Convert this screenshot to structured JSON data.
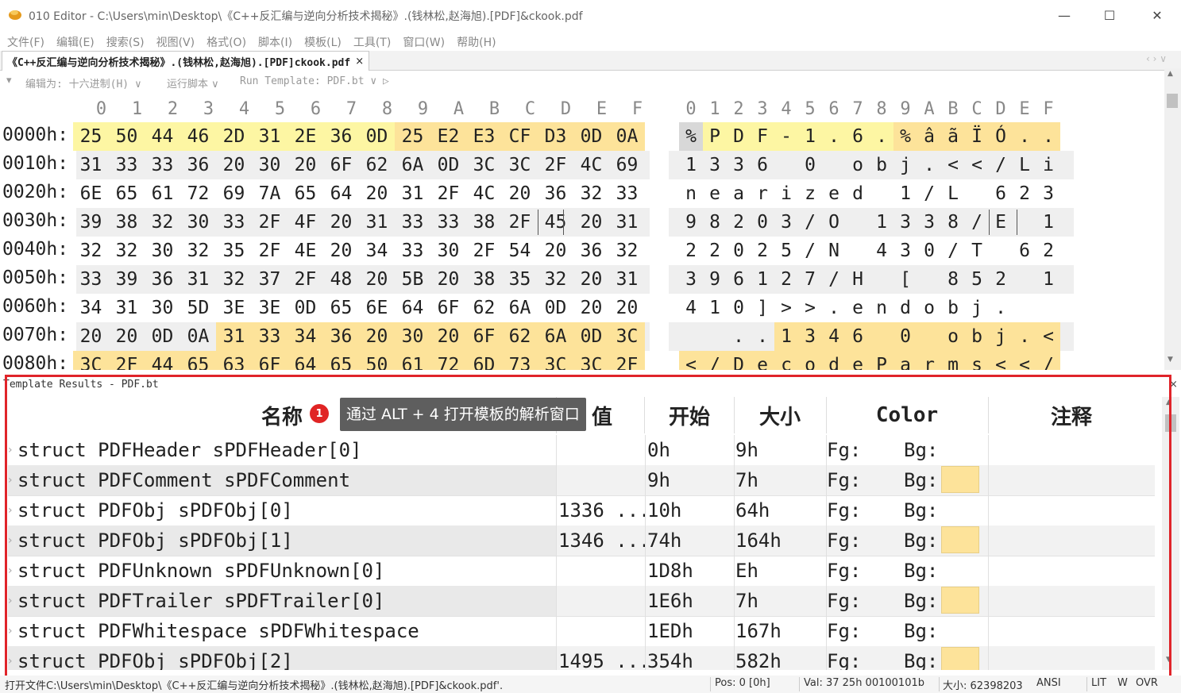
{
  "window": {
    "title": "010 Editor - C:\\Users\\min\\Desktop\\《C++反汇编与逆向分析技术揭秘》.(钱林松,赵海旭).[PDF]&ckook.pdf",
    "min": "—",
    "max": "☐",
    "close": "✕"
  },
  "menu": [
    "文件(F)",
    "编辑(E)",
    "搜索(S)",
    "视图(V)",
    "格式(O)",
    "脚本(I)",
    "模板(L)",
    "工具(T)",
    "窗口(W)",
    "帮助(H)"
  ],
  "tab": {
    "label": "《C++反汇编与逆向分析技术揭秘》.(钱林松,赵海旭).[PDF]ckook.pdf",
    "close": "×",
    "nav": "‹ › ∨"
  },
  "toolbar": {
    "edit_as_label": "编辑为: 十六进制(H) ∨",
    "run_script_label": "运行脚本 ∨",
    "run_template_label": "Run Template: PDF.bt ∨ ▷"
  },
  "hex": {
    "columns": [
      "0",
      "1",
      "2",
      "3",
      "4",
      "5",
      "6",
      "7",
      "8",
      "9",
      "A",
      "B",
      "C",
      "D",
      "E",
      "F"
    ],
    "text_columns": [
      "0",
      "1",
      "2",
      "3",
      "4",
      "5",
      "6",
      "7",
      "8",
      "9",
      "A",
      "B",
      "C",
      "D",
      "E",
      "F"
    ],
    "highlight_color": "#fdf6a3",
    "struct_color": "#fde39a",
    "rows": [
      {
        "addr": "0000h:",
        "bytes": [
          "25",
          "50",
          "44",
          "46",
          "2D",
          "31",
          "2E",
          "36",
          "0D",
          "25",
          "E2",
          "E3",
          "CF",
          "D3",
          "0D",
          "0A"
        ],
        "text": [
          "%",
          "P",
          "D",
          "F",
          "-",
          "1",
          ".",
          "6",
          ".",
          "%",
          "â",
          "ã",
          "Ï",
          "Ó",
          ".",
          "."
        ]
      },
      {
        "addr": "0010h:",
        "bytes": [
          "31",
          "33",
          "33",
          "36",
          "20",
          "30",
          "20",
          "6F",
          "62",
          "6A",
          "0D",
          "3C",
          "3C",
          "2F",
          "4C",
          "69"
        ],
        "text": [
          "1",
          "3",
          "3",
          "6",
          " ",
          "0",
          " ",
          "o",
          "b",
          "j",
          ".",
          "<",
          "<",
          "/",
          "L",
          "i"
        ]
      },
      {
        "addr": "0020h:",
        "bytes": [
          "6E",
          "65",
          "61",
          "72",
          "69",
          "7A",
          "65",
          "64",
          "20",
          "31",
          "2F",
          "4C",
          "20",
          "36",
          "32",
          "33"
        ],
        "text": [
          "n",
          "e",
          "a",
          "r",
          "i",
          "z",
          "e",
          "d",
          " ",
          "1",
          "/",
          "L",
          " ",
          "6",
          "2",
          "3"
        ]
      },
      {
        "addr": "0030h:",
        "bytes": [
          "39",
          "38",
          "32",
          "30",
          "33",
          "2F",
          "4F",
          "20",
          "31",
          "33",
          "33",
          "38",
          "2F",
          "45",
          "20",
          "31"
        ],
        "text": [
          "9",
          "8",
          "2",
          "0",
          "3",
          "/",
          "O",
          " ",
          "1",
          "3",
          "3",
          "8",
          "/",
          "E",
          " ",
          "1"
        ]
      },
      {
        "addr": "0040h:",
        "bytes": [
          "32",
          "32",
          "30",
          "32",
          "35",
          "2F",
          "4E",
          "20",
          "34",
          "33",
          "30",
          "2F",
          "54",
          "20",
          "36",
          "32"
        ],
        "text": [
          "2",
          "2",
          "0",
          "2",
          "5",
          "/",
          "N",
          " ",
          "4",
          "3",
          "0",
          "/",
          "T",
          " ",
          "6",
          "2"
        ]
      },
      {
        "addr": "0050h:",
        "bytes": [
          "33",
          "39",
          "36",
          "31",
          "32",
          "37",
          "2F",
          "48",
          "20",
          "5B",
          "20",
          "38",
          "35",
          "32",
          "20",
          "31"
        ],
        "text": [
          "3",
          "9",
          "6",
          "1",
          "2",
          "7",
          "/",
          "H",
          " ",
          "[",
          " ",
          "8",
          "5",
          "2",
          " ",
          "1"
        ]
      },
      {
        "addr": "0060h:",
        "bytes": [
          "34",
          "31",
          "30",
          "5D",
          "3E",
          "3E",
          "0D",
          "65",
          "6E",
          "64",
          "6F",
          "62",
          "6A",
          "0D",
          "20",
          "20"
        ],
        "text": [
          "4",
          "1",
          "0",
          "]",
          ">",
          ">",
          ".",
          "e",
          "n",
          "d",
          "o",
          "b",
          "j",
          ".",
          " ",
          " "
        ]
      },
      {
        "addr": "0070h:",
        "bytes": [
          "20",
          "20",
          "0D",
          "0A",
          "31",
          "33",
          "34",
          "36",
          "20",
          "30",
          "20",
          "6F",
          "62",
          "6A",
          "0D",
          "3C"
        ],
        "text": [
          " ",
          " ",
          ".",
          ".",
          "1",
          "3",
          "4",
          "6",
          " ",
          "0",
          " ",
          "o",
          "b",
          "j",
          ".",
          "<"
        ]
      },
      {
        "addr": "0080h:",
        "bytes": [
          "3C",
          "2F",
          "44",
          "65",
          "63",
          "6F",
          "64",
          "65",
          "50",
          "61",
          "72",
          "6D",
          "73",
          "3C",
          "3C",
          "2F"
        ],
        "text": [
          "<",
          "/",
          "D",
          "e",
          "c",
          "o",
          "d",
          "e",
          "P",
          "a",
          "r",
          "m",
          "s",
          "<",
          "<",
          "/"
        ]
      }
    ]
  },
  "template_results": {
    "title": "Template Results - PDF.bt",
    "close": "×",
    "headers": {
      "name": "名称",
      "value": "值",
      "start": "开始",
      "size": "大小",
      "color": "Color",
      "comment": "注释"
    },
    "rows": [
      {
        "name": "struct PDFHeader sPDFHeader[0]",
        "value": "",
        "start": "0h",
        "size": "9h",
        "fg": "Fg:",
        "bg": "Bg:",
        "swatch": false
      },
      {
        "name": "struct PDFComment sPDFComment",
        "value": "",
        "start": "9h",
        "size": "7h",
        "fg": "Fg:",
        "bg": "Bg:",
        "swatch": true
      },
      {
        "name": "struct PDFObj sPDFObj[0]",
        "value": "1336 ...",
        "start": "10h",
        "size": "64h",
        "fg": "Fg:",
        "bg": "Bg:",
        "swatch": false
      },
      {
        "name": "struct PDFObj sPDFObj[1]",
        "value": "1346 ...",
        "start": "74h",
        "size": "164h",
        "fg": "Fg:",
        "bg": "Bg:",
        "swatch": true
      },
      {
        "name": "struct PDFUnknown sPDFUnknown[0]",
        "value": "",
        "start": "1D8h",
        "size": "Eh",
        "fg": "Fg:",
        "bg": "Bg:",
        "swatch": false
      },
      {
        "name": "struct PDFTrailer sPDFTrailer[0]",
        "value": "",
        "start": "1E6h",
        "size": "7h",
        "fg": "Fg:",
        "bg": "Bg:",
        "swatch": true
      },
      {
        "name": "struct PDFWhitespace sPDFWhitespace",
        "value": "",
        "start": "1EDh",
        "size": "167h",
        "fg": "Fg:",
        "bg": "Bg:",
        "swatch": false
      },
      {
        "name": "struct PDFObj sPDFObj[2]",
        "value": "1495 ...",
        "start": "354h",
        "size": "582h",
        "fg": "Fg:",
        "bg": "Bg:",
        "swatch": true
      }
    ]
  },
  "tooltip": {
    "badge": "1",
    "text": "通过 ALT + 4 打开模板的解析窗口"
  },
  "status": {
    "file": "打开文件C:\\Users\\min\\Desktop\\《C++反汇编与逆向分析技术揭秘》.(钱林松,赵海旭).[PDF]&ckook.pdf'.",
    "pos": "Pos: 0 [0h]",
    "val": "Val: 37 25h 00100101b",
    "size": "大小: 62398203",
    "encoding": "ANSI",
    "lit": "LIT",
    "w": "W",
    "ovr": "OVR"
  }
}
